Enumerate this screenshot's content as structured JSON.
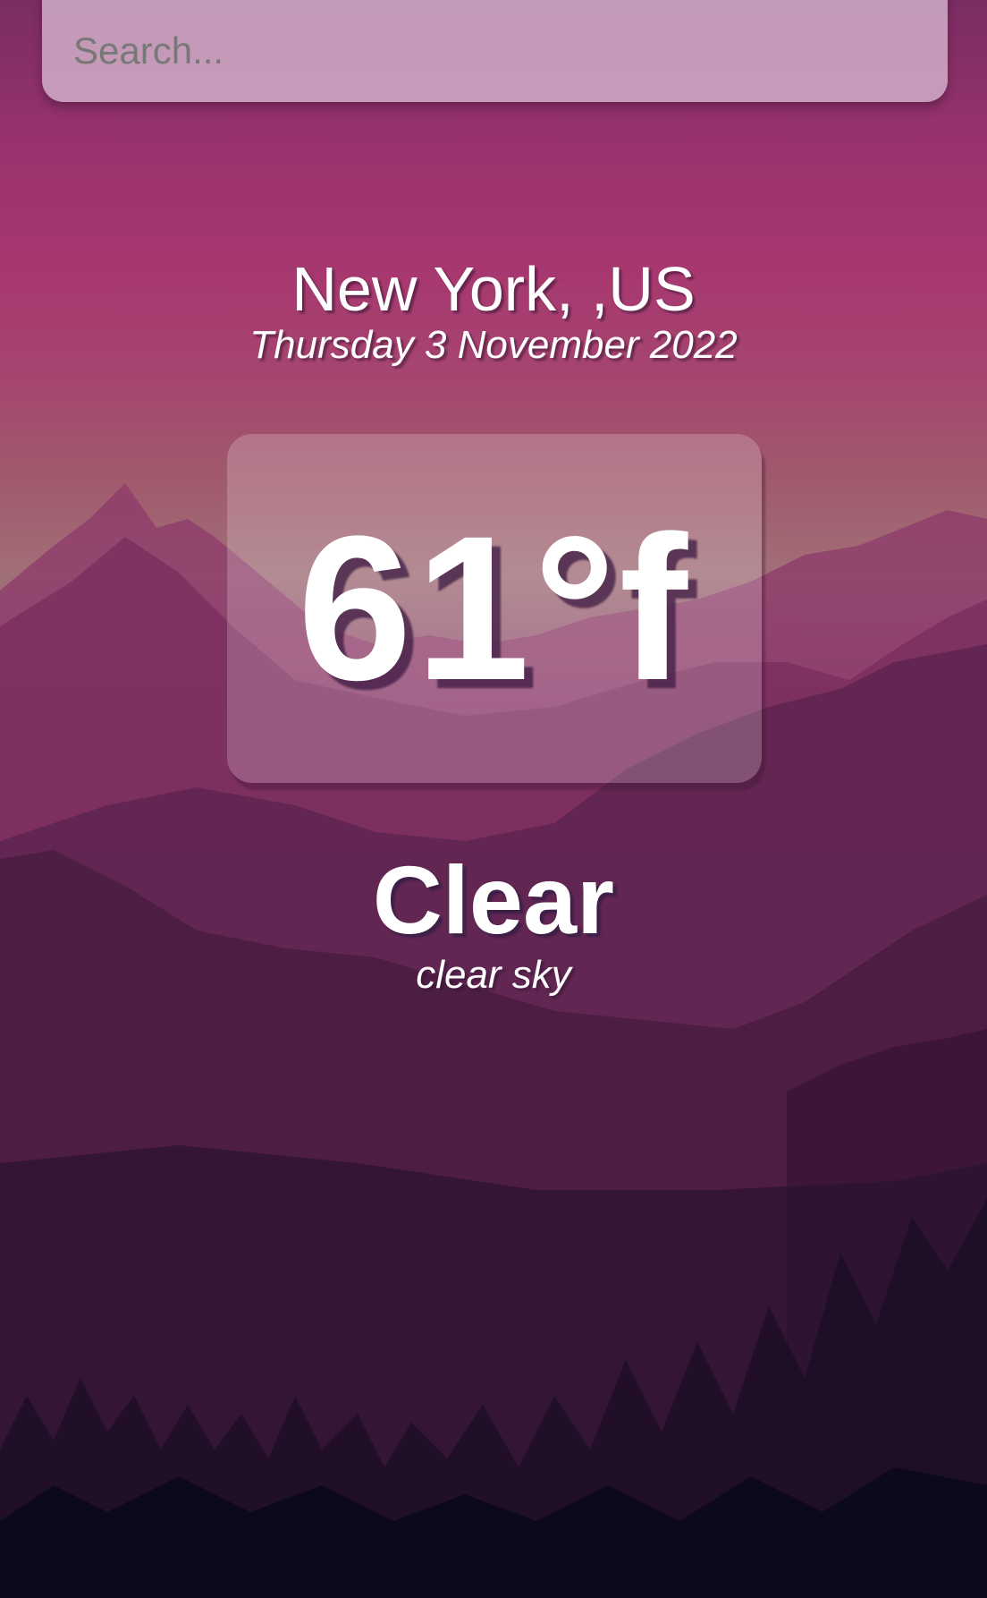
{
  "search": {
    "placeholder": "Search...",
    "value": ""
  },
  "location": {
    "city_country": "New York, ,US",
    "date": "Thursday 3 November 2022"
  },
  "temperature": {
    "display": "61°f"
  },
  "weather": {
    "main": "Clear",
    "description": "clear sky"
  },
  "theme": {
    "sky_top": "#7a2d62",
    "sky_glow": "#a16f78",
    "mountain": "#8a3868",
    "ground_dark": "#0b0a1a",
    "text": "#ffffff"
  }
}
